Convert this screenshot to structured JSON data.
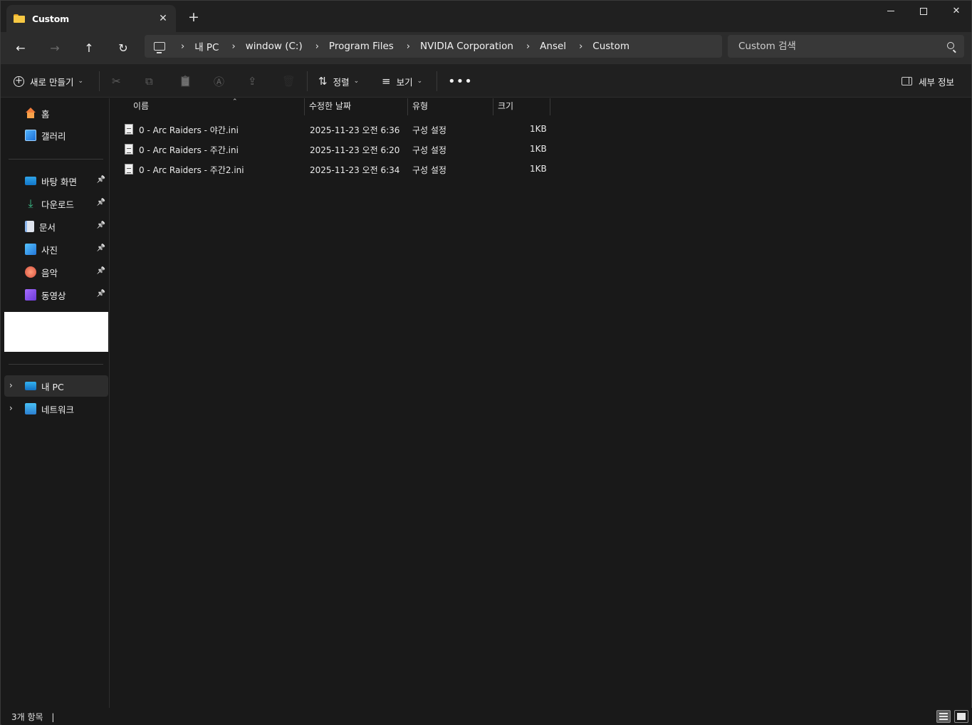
{
  "tab": {
    "title": "Custom",
    "close_glyph": "✕",
    "new_tab_glyph": "+"
  },
  "window_controls": {
    "close_glyph": "✕"
  },
  "nav": {
    "back": "←",
    "forward": "→",
    "up": "↑",
    "refresh": "↻"
  },
  "breadcrumb": {
    "separator": "›",
    "items": [
      "내 PC",
      "window (C:)",
      "Program Files",
      "NVIDIA Corporation",
      "Ansel",
      "Custom"
    ]
  },
  "search": {
    "placeholder": "Custom 검색"
  },
  "commandbar": {
    "new_label": "새로 만들기",
    "cut_icon": "✂",
    "copy_icon": "⧉",
    "paste_icon": "📋",
    "rename_icon": "Ⓐ",
    "share_icon": "⇪",
    "delete_icon": "🗑",
    "sort_label": "정렬",
    "sort_icon": "⇅",
    "view_label": "보기",
    "view_icon": "≡",
    "more_icon": "•••",
    "details_label": "세부 정보",
    "dropdown_glyph": "⌄"
  },
  "sidebar": {
    "top_items": [
      {
        "label": "홈",
        "icon": "home-icon"
      },
      {
        "label": "갤러리",
        "icon": "gallery-icon"
      }
    ],
    "pinned_items": [
      {
        "label": "바탕 화면",
        "icon": "desktop-icon"
      },
      {
        "label": "다운로드",
        "icon": "download-icon"
      },
      {
        "label": "문서",
        "icon": "documents-icon"
      },
      {
        "label": "사진",
        "icon": "pictures-icon"
      },
      {
        "label": "음악",
        "icon": "music-icon"
      },
      {
        "label": "동영상",
        "icon": "videos-icon"
      }
    ],
    "pin_glyph": "📌",
    "download_glyph": "⤓",
    "expander_glyph": "›",
    "tree_items": [
      {
        "label": "내 PC",
        "icon": "this-pc-icon",
        "selected": true
      },
      {
        "label": "네트워크",
        "icon": "network-icon",
        "selected": false
      }
    ]
  },
  "file_list": {
    "columns": [
      "이름",
      "수정한 날짜",
      "유형",
      "크기"
    ],
    "sort_indicator": "⌃",
    "rows": [
      {
        "name": "0 - Arc Raiders - 야간.ini",
        "modified": "2025-11-23 오전 6:36",
        "type": "구성 설정",
        "size": "1KB"
      },
      {
        "name": "0 - Arc Raiders - 주간.ini",
        "modified": "2025-11-23 오전 6:20",
        "type": "구성 설정",
        "size": "1KB"
      },
      {
        "name": "0 - Arc Raiders - 주간2.ini",
        "modified": "2025-11-23 오전 6:34",
        "type": "구성 설정",
        "size": "1KB"
      }
    ]
  },
  "status": {
    "item_count": "3개 항목",
    "separator": "|"
  },
  "colors": {
    "background": "#191919",
    "toolbar": "#202020",
    "address": "#2c2c2c",
    "folder": "#f7c843"
  }
}
